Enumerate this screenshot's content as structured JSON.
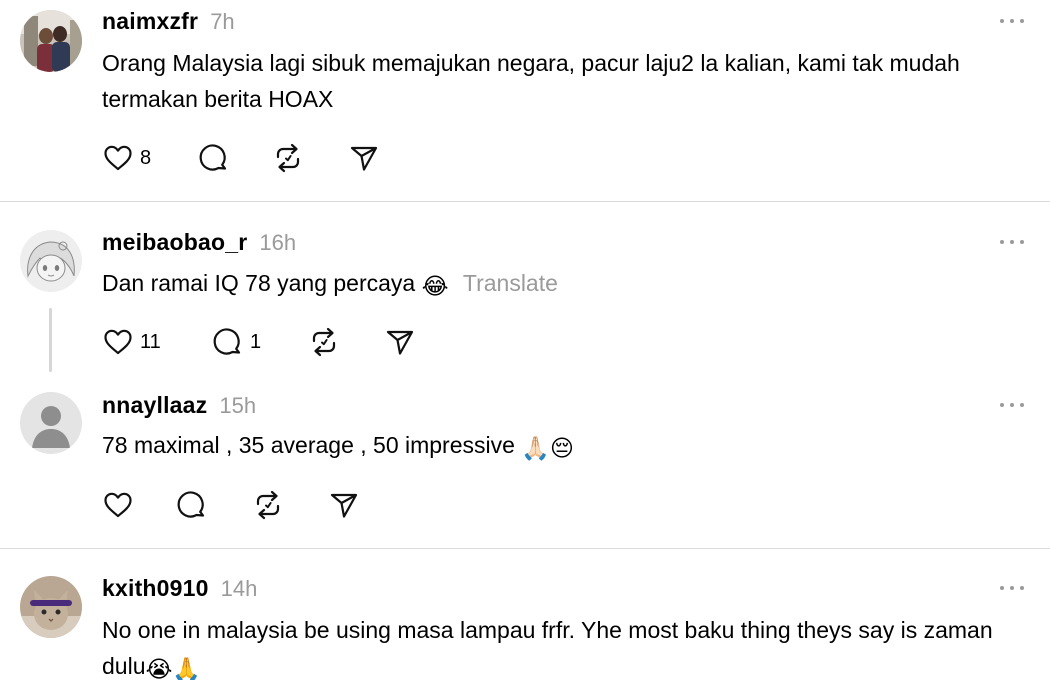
{
  "posts": [
    {
      "username": "naimxzfr",
      "time": "7h",
      "text": "Orang Malaysia lagi sibuk memajukan negara, pacur laju2 la kalian, kami tak mudah termakan berita HOAX",
      "like_count": "8",
      "reply_count": "",
      "avatar": "photo-avatar"
    },
    {
      "username": "meibaobao_r",
      "time": "16h",
      "text": "Dan ramai IQ 78 yang percaya",
      "emoji": "😂",
      "translate_label": "Translate",
      "like_count": "11",
      "reply_count": "1",
      "avatar": "anime-sketch-avatar"
    },
    {
      "username": "nnayllaaz",
      "time": "15h",
      "text": "78 maximal , 35 average , 50 impressive",
      "emoji": "🙏🏻😔",
      "like_count": "",
      "reply_count": "",
      "avatar": "default-person-avatar"
    },
    {
      "username": "kxith0910",
      "time": "14h",
      "text": "No one in malaysia be using masa lampau frfr. Yhe most baku thing theys say is zaman dulu",
      "emoji": "😭🙏",
      "avatar": "cat-photo-avatar"
    }
  ],
  "icons": {
    "like": "heart-icon",
    "reply": "comment-icon",
    "repost": "repost-icon",
    "share": "send-icon",
    "more": "more-dots-icon"
  },
  "colors": {
    "text": "#000000",
    "muted": "#9a9a9a",
    "divider": "#dbdbdb"
  }
}
